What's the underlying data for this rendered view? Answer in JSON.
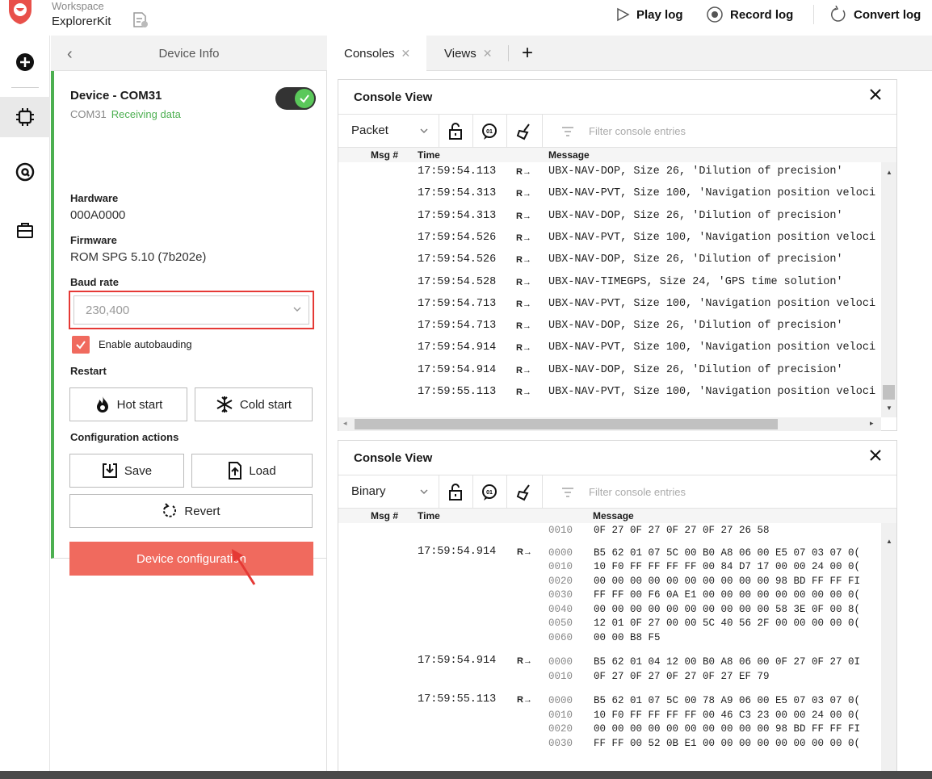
{
  "workspace": {
    "label": "Workspace",
    "name": "ExplorerKit"
  },
  "top_actions": {
    "play": "Play log",
    "record": "Record log",
    "convert": "Convert log"
  },
  "panel": {
    "title": "Device Info",
    "device_name": "Device - COM31",
    "port": "COM31",
    "status": "Receiving data",
    "hardware_label": "Hardware",
    "hardware_value": "000A0000",
    "firmware_label": "Firmware",
    "firmware_value": "ROM SPG 5.10 (7b202e)",
    "baud_label": "Baud rate",
    "baud_value": "230,400",
    "autobaud_label": "Enable autobauding",
    "restart_label": "Restart",
    "hot_start": "Hot start",
    "cold_start": "Cold start",
    "config_label": "Configuration actions",
    "save": "Save",
    "load": "Load",
    "revert": "Revert",
    "device_config": "Device configuration"
  },
  "tabs": [
    {
      "label": "Consoles"
    },
    {
      "label": "Views"
    }
  ],
  "console1": {
    "title": "Console View",
    "mode": "Packet",
    "filter_placeholder": "Filter console entries",
    "col_msg": "Msg #",
    "col_time": "Time",
    "col_message": "Message",
    "rows": [
      {
        "time": "17:59:54.113",
        "dir": "R→",
        "msg": "UBX-NAV-DOP, Size 26, 'Dilution of precision'"
      },
      {
        "time": "17:59:54.313",
        "dir": "R→",
        "msg": "UBX-NAV-PVT, Size 100, 'Navigation position veloci"
      },
      {
        "time": "17:59:54.313",
        "dir": "R→",
        "msg": "UBX-NAV-DOP, Size 26, 'Dilution of precision'"
      },
      {
        "time": "17:59:54.526",
        "dir": "R→",
        "msg": "UBX-NAV-PVT, Size 100, 'Navigation position veloci"
      },
      {
        "time": "17:59:54.526",
        "dir": "R→",
        "msg": "UBX-NAV-DOP, Size 26, 'Dilution of precision'"
      },
      {
        "time": "17:59:54.528",
        "dir": "R→",
        "msg": "UBX-NAV-TIMEGPS, Size 24, 'GPS time solution'"
      },
      {
        "time": "17:59:54.713",
        "dir": "R→",
        "msg": "UBX-NAV-PVT, Size 100, 'Navigation position veloci"
      },
      {
        "time": "17:59:54.713",
        "dir": "R→",
        "msg": "UBX-NAV-DOP, Size 26, 'Dilution of precision'"
      },
      {
        "time": "17:59:54.914",
        "dir": "R→",
        "msg": "UBX-NAV-PVT, Size 100, 'Navigation position veloci"
      },
      {
        "time": "17:59:54.914",
        "dir": "R→",
        "msg": "UBX-NAV-DOP, Size 26, 'Dilution of precision'"
      },
      {
        "time": "17:59:55.113",
        "dir": "R→",
        "msg": "UBX-NAV-PVT, Size 100, 'Navigation position veloci"
      }
    ]
  },
  "console2": {
    "title": "Console View",
    "mode": "Binary",
    "filter_placeholder": "Filter console entries",
    "col_msg": "Msg #",
    "col_time": "Time",
    "col_message": "Message",
    "entries": [
      {
        "time": "",
        "dir": "",
        "lines": [
          {
            "off": "0010",
            "hex": "0F 27 0F 27 0F 27 0F 27 26 58"
          }
        ]
      },
      {
        "time": "17:59:54.914",
        "dir": "R→",
        "lines": [
          {
            "off": "0000",
            "hex": "B5 62 01 07 5C 00 B0 A8 06 00 E5 07 03 07 0("
          },
          {
            "off": "0010",
            "hex": "10 F0 FF FF FF FF 00 84 D7 17 00 00 24 00 0("
          },
          {
            "off": "0020",
            "hex": "00 00 00 00 00 00 00 00 00 00 98 BD FF FF FI"
          },
          {
            "off": "0030",
            "hex": "FF FF 00 F6 0A E1 00 00 00 00 00 00 00 00 0("
          },
          {
            "off": "0040",
            "hex": "00 00 00 00 00 00 00 00 00 00 58 3E 0F 00 8("
          },
          {
            "off": "0050",
            "hex": "12 01 0F 27 00 00 5C 40 56 2F 00 00 00 00 0("
          },
          {
            "off": "0060",
            "hex": "00 00 B8 F5"
          }
        ]
      },
      {
        "time": "17:59:54.914",
        "dir": "R→",
        "lines": [
          {
            "off": "0000",
            "hex": "B5 62 01 04 12 00 B0 A8 06 00 0F 27 0F 27 0I"
          },
          {
            "off": "0010",
            "hex": "0F 27 0F 27 0F 27 0F 27 EF 79"
          }
        ]
      },
      {
        "time": "17:59:55.113",
        "dir": "R→",
        "lines": [
          {
            "off": "0000",
            "hex": "B5 62 01 07 5C 00 78 A9 06 00 E5 07 03 07 0("
          },
          {
            "off": "0010",
            "hex": "10 F0 FF FF FF FF 00 46 C3 23 00 00 24 00 0("
          },
          {
            "off": "0020",
            "hex": "00 00 00 00 00 00 00 00 00 00 98 BD FF FF FI"
          },
          {
            "off": "0030",
            "hex": "FF FF 00 52 0B E1 00 00 00 00 00 00 00 00 0("
          }
        ]
      }
    ]
  }
}
